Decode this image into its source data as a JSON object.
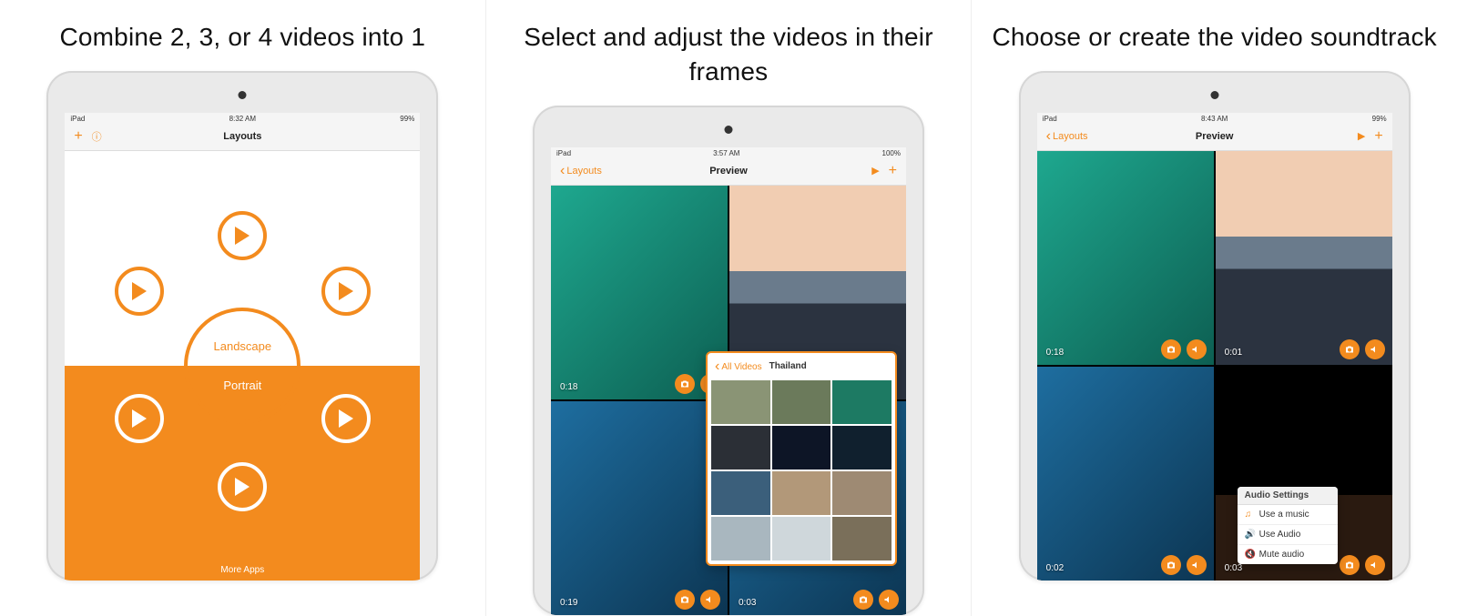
{
  "panels": [
    {
      "caption": "Combine 2, 3, or 4 videos into 1",
      "status": {
        "carrier": "iPad",
        "time": "8:32 AM",
        "battery": "99%"
      },
      "nav": {
        "title": "Layouts"
      },
      "center": {
        "landscape": "Landscape",
        "portrait": "Portrait"
      },
      "more_apps": "More Apps"
    },
    {
      "caption": "Select and adjust the videos in their frames",
      "status": {
        "carrier": "iPad",
        "time": "3:57 AM",
        "battery": "100%"
      },
      "nav": {
        "back": "Layouts",
        "title": "Preview"
      },
      "cells": [
        {
          "time": "0:18"
        },
        {
          "time": ""
        },
        {
          "time": "0:19"
        },
        {
          "time": "0:03"
        }
      ],
      "album": {
        "back": "All Videos",
        "name": "Thailand"
      }
    },
    {
      "caption": "Choose or create the video soundtrack",
      "status": {
        "carrier": "iPad",
        "time": "8:43 AM",
        "battery": "99%"
      },
      "nav": {
        "back": "Layouts",
        "title": "Preview"
      },
      "cells": [
        {
          "time": "0:18"
        },
        {
          "time": "0:01"
        },
        {
          "time": "0:02"
        },
        {
          "time": "0:03"
        }
      ],
      "audio_menu": {
        "header": "Audio Settings",
        "items": [
          "Use a music",
          "Use Audio",
          "Mute audio"
        ]
      }
    }
  ]
}
